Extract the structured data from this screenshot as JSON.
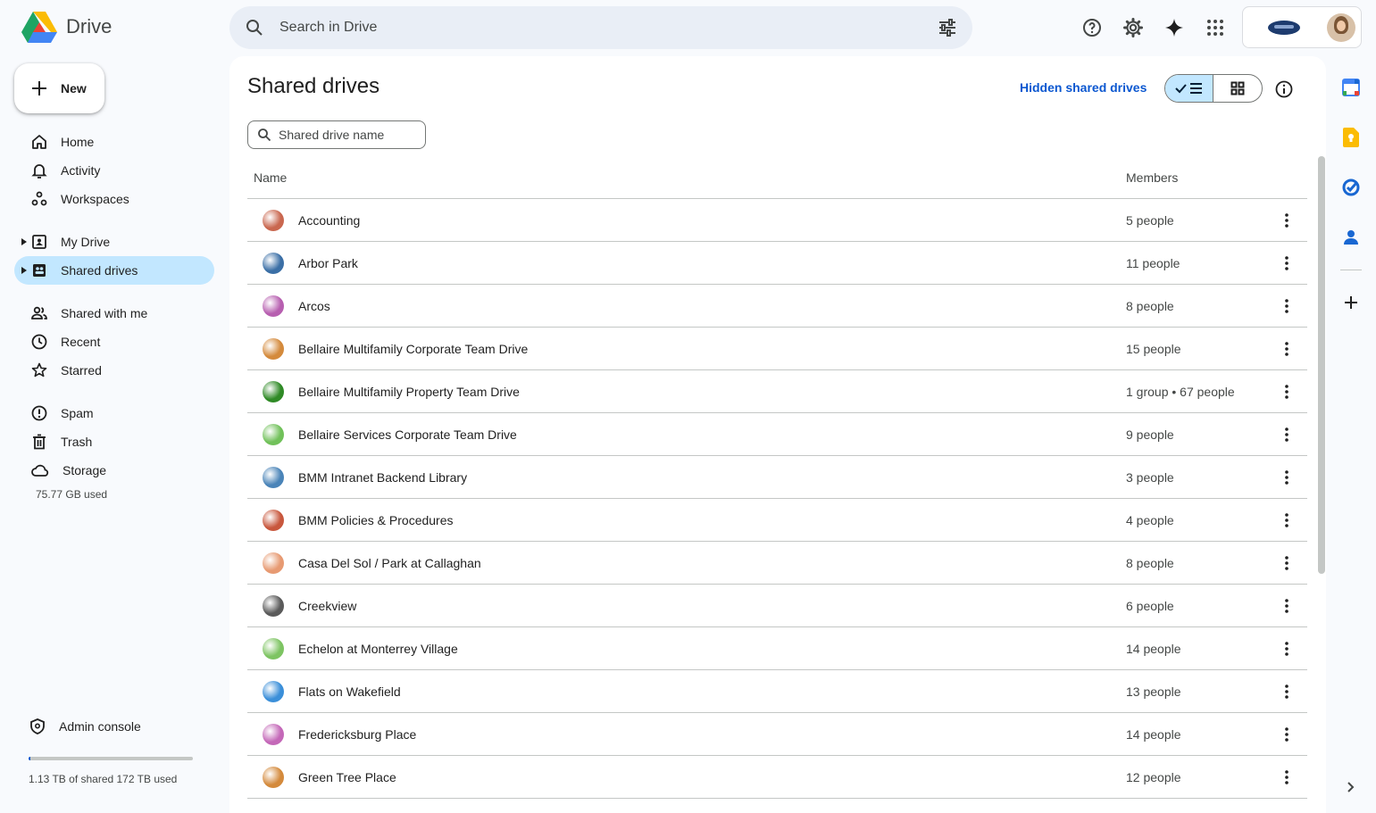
{
  "app": {
    "name": "Drive"
  },
  "search": {
    "placeholder": "Search in Drive"
  },
  "sidebar": {
    "new_label": "New",
    "items": [
      {
        "label": "Home",
        "icon": "home-icon"
      },
      {
        "label": "Activity",
        "icon": "bell-icon"
      },
      {
        "label": "Workspaces",
        "icon": "workspaces-icon"
      },
      {
        "label": "My Drive",
        "icon": "my-drive-icon"
      },
      {
        "label": "Shared drives",
        "icon": "shared-drives-icon",
        "active": true
      },
      {
        "label": "Shared with me",
        "icon": "people-icon"
      },
      {
        "label": "Recent",
        "icon": "clock-icon"
      },
      {
        "label": "Starred",
        "icon": "star-icon"
      },
      {
        "label": "Spam",
        "icon": "spam-icon"
      },
      {
        "label": "Trash",
        "icon": "trash-icon"
      },
      {
        "label": "Storage",
        "icon": "cloud-icon"
      }
    ],
    "storage_used": "75.77 GB used",
    "admin_label": "Admin console",
    "shared_storage_text": "1.13 TB of shared 172 TB used",
    "shared_storage_fraction": 0.0066
  },
  "main": {
    "title": "Shared drives",
    "hidden_link": "Hidden shared drives",
    "filter_placeholder": "Shared drive name",
    "columns": {
      "name": "Name",
      "members": "Members"
    },
    "rows": [
      {
        "name": "Accounting",
        "members": "5 people",
        "color": "#c9674f"
      },
      {
        "name": "Arbor Park",
        "members": "11 people",
        "color": "#3b6fa6"
      },
      {
        "name": "Arcos",
        "members": "8 people",
        "color": "#b75fb0"
      },
      {
        "name": "Bellaire Multifamily Corporate Team Drive",
        "members": "15 people",
        "color": "#d48a3c"
      },
      {
        "name": "Bellaire Multifamily Property Team Drive",
        "members": "1 group • 67 people",
        "color": "#2f8a26"
      },
      {
        "name": "Bellaire Services Corporate Team Drive",
        "members": "9 people",
        "color": "#71c15a"
      },
      {
        "name": "BMM Intranet Backend Library",
        "members": "3 people",
        "color": "#4a84b8"
      },
      {
        "name": "BMM Policies & Procedures",
        "members": "4 people",
        "color": "#c8573d"
      },
      {
        "name": "Casa Del Sol / Park at Callaghan",
        "members": "8 people",
        "color": "#e79a72"
      },
      {
        "name": "Creekview",
        "members": "6 people",
        "color": "#5a5a5a"
      },
      {
        "name": "Echelon at Monterrey Village",
        "members": "14 people",
        "color": "#7dc462"
      },
      {
        "name": "Flats on Wakefield",
        "members": "13 people",
        "color": "#3b8fd9"
      },
      {
        "name": "Fredericksburg Place",
        "members": "14 people",
        "color": "#c468b8"
      },
      {
        "name": "Green Tree Place",
        "members": "12 people",
        "color": "#d48a3c"
      }
    ]
  }
}
